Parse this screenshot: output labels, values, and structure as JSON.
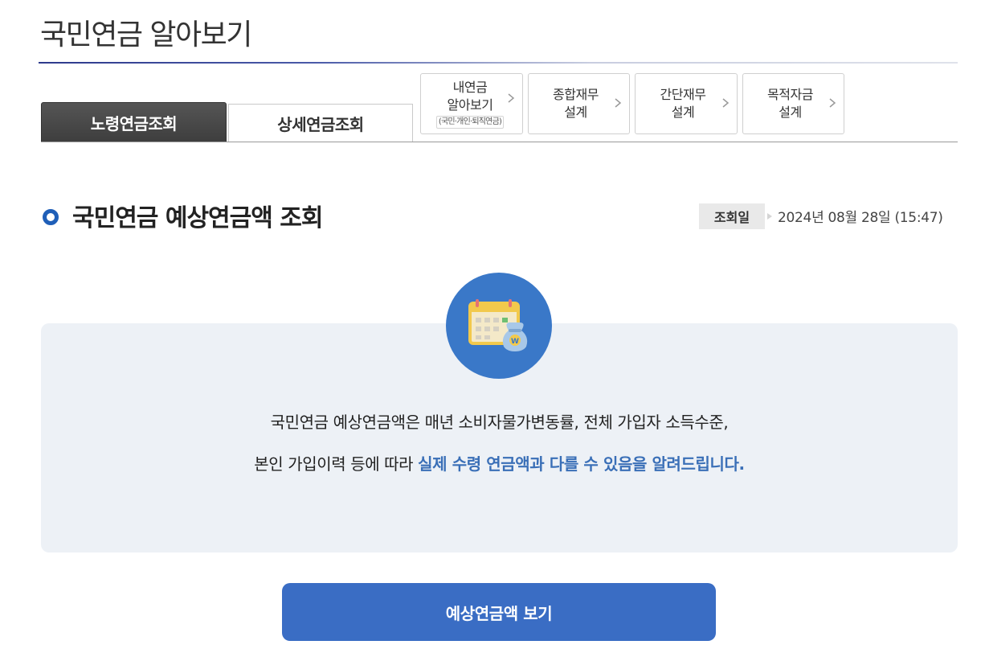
{
  "page": {
    "title": "국민연금 알아보기"
  },
  "tabs": [
    {
      "label": "노령연금조회",
      "active": true
    },
    {
      "label": "상세연금조회",
      "active": false
    }
  ],
  "quick_links": [
    {
      "line1": "내연금",
      "line2": "알아보기",
      "sub": "(국민·개인·퇴직연금)",
      "icon": "chevron-right-icon"
    },
    {
      "line1": "종합재무",
      "line2": "설계",
      "icon": "chevron-right-icon"
    },
    {
      "line1": "간단재무",
      "line2": "설계",
      "icon": "chevron-right-icon"
    },
    {
      "line1": "목적자금",
      "line2": "설계",
      "icon": "chevron-right-icon"
    }
  ],
  "section": {
    "title": "국민연금 예상연금액 조회",
    "date_label": "조회일",
    "date_value": "2024년 08월 28일 (15:47)"
  },
  "info": {
    "icon": "calendar-money-icon",
    "line1": "국민연금 예상연금액은 매년 소비자물가변동률, 전체 가입자 소득수준,",
    "line2_prefix": "본인 가입이력 등에 따라 ",
    "line2_highlight": "실제 수령 연금액과 다를 수 있음을 알려드립니다."
  },
  "button": {
    "label": "예상연금액 보기"
  },
  "colors": {
    "primary": "#3a6dc4",
    "highlight": "#3a6fb7",
    "panel_bg": "#edf1f6",
    "active_tab": "#444444",
    "icon_circle": "#3a78c8"
  }
}
